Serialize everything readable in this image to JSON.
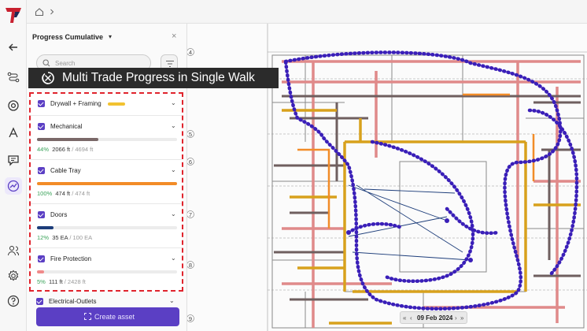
{
  "banner": {
    "title": "Multi Trade Progress in Single Walk"
  },
  "panel": {
    "title": "Progress Cumulative",
    "search_placeholder": "Search"
  },
  "trades": [
    {
      "name": "Drywall + Framing",
      "color": "#f2c230"
    },
    {
      "name": "Mechanical",
      "progress": 44,
      "pct_label": "44%",
      "done": "2066 ft",
      "total": "/ 4694 ft",
      "color": "#7a6868"
    },
    {
      "name": "Cable Tray",
      "progress": 100,
      "pct_label": "100%",
      "done": "474 ft",
      "total": "/ 474 ft",
      "color": "#f28c28"
    },
    {
      "name": "Doors",
      "progress": 12,
      "pct_label": "12%",
      "done": "35 EA",
      "total": "/ 100 EA",
      "color": "#1d3d7a"
    },
    {
      "name": "Fire Protection",
      "progress": 5,
      "pct_label": "5%",
      "done": "111 ft",
      "total": "/ 2428 ft",
      "color": "#f08a8a"
    },
    {
      "name": "Electrical-Outlets"
    }
  ],
  "create_button": {
    "label": "Create asset"
  },
  "date_nav": {
    "prev2": "«",
    "prev": "‹",
    "date": "09 Feb 2024",
    "next": "›",
    "next2": "»"
  },
  "plan_markers": [
    "4",
    "5",
    "6",
    "7",
    "8",
    "9"
  ],
  "colors": {
    "accent": "#5b3fc4",
    "walk_path": "#3a1fb8",
    "highlight": "#e0242d"
  }
}
